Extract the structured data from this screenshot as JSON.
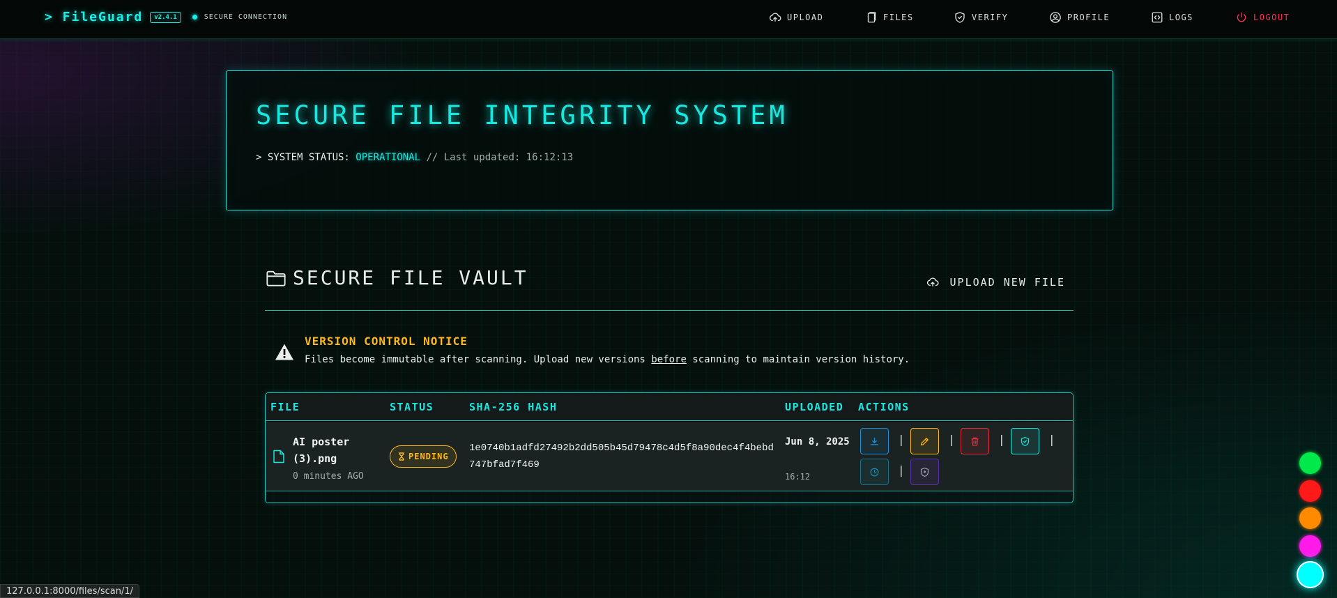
{
  "nav": {
    "brand": "> FileGuard",
    "version": "v2.4.1",
    "connection": "SECURE CONNECTION",
    "items": [
      {
        "label": "UPLOAD",
        "icon": "cloud-upload-icon"
      },
      {
        "label": "FILES",
        "icon": "files-icon"
      },
      {
        "label": "VERIFY",
        "icon": "shield-check-icon"
      },
      {
        "label": "PROFILE",
        "icon": "user-circle-icon"
      },
      {
        "label": "LOGS",
        "icon": "code-icon"
      },
      {
        "label": "LOGOUT",
        "icon": "power-icon"
      }
    ]
  },
  "hero": {
    "title": "SECURE FILE INTEGRITY SYSTEM",
    "status_prefix": "> SYSTEM STATUS:",
    "status_value": "OPERATIONAL",
    "updated": "// Last updated: 16:12:13"
  },
  "vault": {
    "title": "SECURE FILE VAULT",
    "upload_label": "UPLOAD NEW FILE"
  },
  "notice": {
    "title": "VERSION CONTROL NOTICE",
    "text_before": "Files become immutable after scanning. Upload new versions ",
    "text_emph": "before",
    "text_after": " scanning to maintain version history."
  },
  "table": {
    "headers": [
      "FILE",
      "STATUS",
      "SHA-256 HASH",
      "UPLOADED",
      "ACTIONS"
    ],
    "rows": [
      {
        "name": "AI poster (3).png",
        "age": "0 minutes AGO",
        "status": "PENDING",
        "hash": "1e0740b1adfd27492b2dd505b45d79478c4d5f8a90dec4f4bebd747bfad7f469",
        "date": "Jun 8, 2025",
        "time": "16:12"
      }
    ]
  },
  "actions": [
    {
      "name": "download-button",
      "icon": "download-icon",
      "color": "#1f8fd8"
    },
    {
      "name": "edit-button",
      "icon": "pencil-icon",
      "color": "#ffb81c"
    },
    {
      "name": "delete-button",
      "icon": "trash-icon",
      "color": "#e8313f"
    },
    {
      "name": "scan-button",
      "icon": "shield-check-icon",
      "color": "#18e8e0"
    },
    {
      "name": "history-button",
      "icon": "clock-icon",
      "color": "#1a8fb0"
    },
    {
      "name": "verify-button",
      "icon": "shield-icon",
      "color": "#7a3fd8"
    }
  ],
  "theme_colors": [
    "#00e84a",
    "#ff1a1a",
    "#ff8a00",
    "#ff1ae8",
    "#00ffff"
  ],
  "statusbar": {
    "url": "127.0.0.1:8000/files/scan/1/"
  }
}
